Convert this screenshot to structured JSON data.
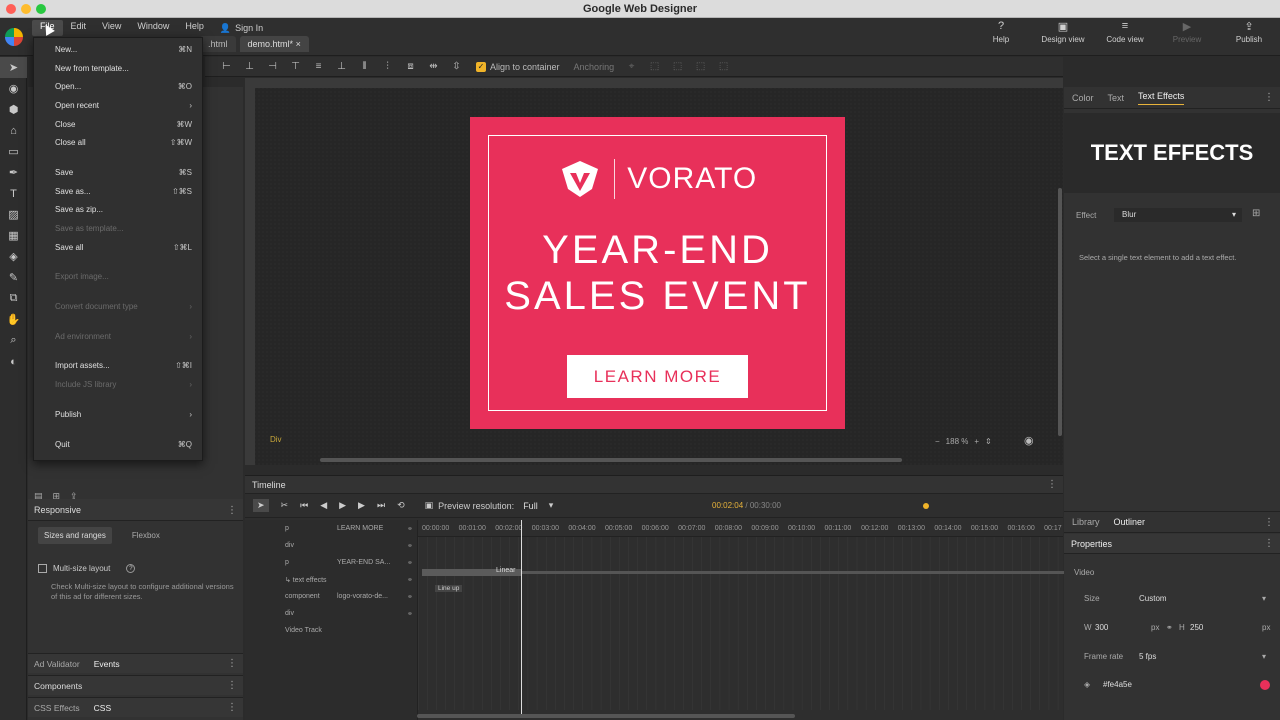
{
  "window": {
    "title": "Google Web Designer"
  },
  "menubar": {
    "items": [
      "File",
      "Edit",
      "View",
      "Window",
      "Help"
    ],
    "sign_in": "Sign In"
  },
  "doc_tabs": [
    ".html",
    "demo.html*"
  ],
  "top_right": [
    {
      "label": "Help",
      "icon": "help-icon"
    },
    {
      "label": "Design view",
      "icon": "design-view-icon"
    },
    {
      "label": "Code view",
      "icon": "code-view-icon"
    },
    {
      "label": "Preview",
      "icon": "preview-icon"
    },
    {
      "label": "Publish",
      "icon": "publish-icon"
    }
  ],
  "file_menu": {
    "groups": [
      [
        {
          "label": "New...",
          "shortcut": "⌘N",
          "enabled": true
        },
        {
          "label": "New from template...",
          "shortcut": "",
          "enabled": true
        },
        {
          "label": "Open...",
          "shortcut": "⌘O",
          "enabled": true
        },
        {
          "label": "Open recent",
          "shortcut": "›",
          "enabled": true
        },
        {
          "label": "Close",
          "shortcut": "⌘W",
          "enabled": true
        },
        {
          "label": "Close all",
          "shortcut": "⇧⌘W",
          "enabled": true
        }
      ],
      [
        {
          "label": "Save",
          "shortcut": "⌘S",
          "enabled": true
        },
        {
          "label": "Save as...",
          "shortcut": "⇧⌘S",
          "enabled": true
        },
        {
          "label": "Save as zip...",
          "shortcut": "",
          "enabled": true
        },
        {
          "label": "Save as template...",
          "shortcut": "",
          "enabled": false
        },
        {
          "label": "Save all",
          "shortcut": "⇧⌘L",
          "enabled": true
        }
      ],
      [
        {
          "label": "Export image...",
          "shortcut": "",
          "enabled": false
        }
      ],
      [
        {
          "label": "Convert document type",
          "shortcut": "›",
          "enabled": false
        }
      ],
      [
        {
          "label": "Ad environment",
          "shortcut": "›",
          "enabled": false
        }
      ],
      [
        {
          "label": "Import assets...",
          "shortcut": "⇧⌘I",
          "enabled": true
        },
        {
          "label": "Include JS library",
          "shortcut": "›",
          "enabled": false
        }
      ],
      [
        {
          "label": "Publish",
          "shortcut": "›",
          "enabled": true
        }
      ],
      [
        {
          "label": "Quit",
          "shortcut": "⌘Q",
          "enabled": true
        }
      ]
    ]
  },
  "toolbar": {
    "align_to_container": "Align to container",
    "anchoring": "Anchoring"
  },
  "stage": {
    "element_label": "Div",
    "zoom": "188 %",
    "ad": {
      "background": "#e8305a",
      "brand": "VORATO",
      "headline_line1": "YEAR-END",
      "headline_line2": "SALES EVENT",
      "cta": "LEARN MORE"
    }
  },
  "left_panel": {
    "responsive": "Responsive",
    "tabs": [
      "Sizes and ranges",
      "Flexbox"
    ],
    "multi_size_label": "Multi-size layout",
    "multi_size_desc": "Check Multi-size layout to configure additional versions of this ad for different sizes.",
    "bottom_tabs": [
      {
        "label": "Ad Validator"
      },
      {
        "label": "Events"
      }
    ],
    "components": "Components",
    "css_tabs": [
      "CSS Effects",
      "CSS"
    ]
  },
  "timeline": {
    "title": "Timeline",
    "preview_resolution_label": "Preview resolution:",
    "preview_resolution_value": "Full",
    "current_time": "00:02:04",
    "total_time": "/ 00:30:00",
    "ticks": [
      "00:00:00",
      "00:01:00",
      "00:02:00",
      "00:03:00",
      "00:04:00",
      "00:05:00",
      "00:06:00",
      "00:07:00",
      "00:08:00",
      "00:09:00",
      "00:10:00",
      "00:11:00",
      "00:12:00",
      "00:13:00",
      "00:14:00",
      "00:15:00",
      "00:16:00",
      "00:17"
    ],
    "layers": [
      {
        "name": "p",
        "value": "LEARN MORE"
      },
      {
        "name": "div",
        "value": ""
      },
      {
        "name": "p",
        "value": "YEAR-END SA..."
      },
      {
        "name": "↳  text effects",
        "value": ""
      },
      {
        "name": "component",
        "value": "logo-vorato-de..."
      },
      {
        "name": "div",
        "value": ""
      },
      {
        "name": "Video Track",
        "value": ""
      }
    ],
    "linear_label": "Linear",
    "lineup_label": "Line up"
  },
  "right_panel": {
    "tabs": [
      "Color",
      "Text",
      "Text Effects"
    ],
    "preview_text": "TEXT EFFECTS",
    "effect_label": "Effect",
    "effect_value": "Blur",
    "hint": "Select a single text element to add a text effect.",
    "lower_tabs": [
      "Library",
      "Outliner"
    ],
    "properties": "Properties",
    "video_label": "Video",
    "size_label": "Size",
    "size_value": "Custom",
    "w_label": "W",
    "w_value": "300",
    "h_label": "H",
    "h_value": "250",
    "unit": "px",
    "frame_rate_label": "Frame rate",
    "frame_rate_value": "5 fps",
    "color_value": "#fe4a5e"
  }
}
